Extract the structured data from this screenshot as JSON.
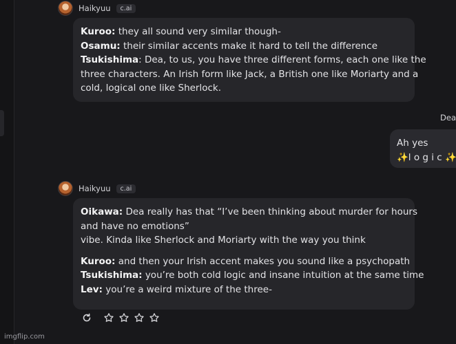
{
  "messages": [
    {
      "char_name": "Haikyuu",
      "badge": "c.ai",
      "lines": [
        {
          "speaker": "Kuroo:",
          "text": " they all sound very similar though-"
        },
        {
          "speaker": "Osamu:",
          "text": " their similar accents make it hard to tell the difference"
        },
        {
          "speaker": "Tsukishima",
          "text": ": Dea, to us, you have three different forms, each one like the"
        },
        {
          "speaker": "",
          "text": "three characters. An Irish form like Jack, a British one like Moriarty and a"
        },
        {
          "speaker": "",
          "text": "cold, logical one like Sherlock."
        }
      ]
    },
    {
      "char_name": "Haikyuu",
      "badge": "c.ai",
      "lines": [
        {
          "speaker": "Oikawa:",
          "text": " Dea really has that “I’ve been thinking about murder for hours"
        },
        {
          "speaker": "",
          "text": "and have no emotions”"
        },
        {
          "speaker": "",
          "text": "vibe. Kinda like Sherlock and Moriarty with the way you think"
        },
        {
          "speaker": "Kuroo:",
          "text": " and then your Irish accent makes you sound like a psychopath"
        },
        {
          "speaker": "Tsukishima:",
          "text": " you’re both cold logic and insane intuition at the same time"
        },
        {
          "speaker": "Lev:",
          "text": " you’re a weird mixture of the three-"
        }
      ]
    }
  ],
  "user_message": {
    "name": "Dea",
    "line1": "Ah yes",
    "line2": "✨l o g i c ✨"
  },
  "rating": {
    "stars": 0,
    "max": 4
  },
  "icons": {
    "regenerate": "refresh-icon",
    "star": "star-icon"
  },
  "watermark": "imgflip.com"
}
